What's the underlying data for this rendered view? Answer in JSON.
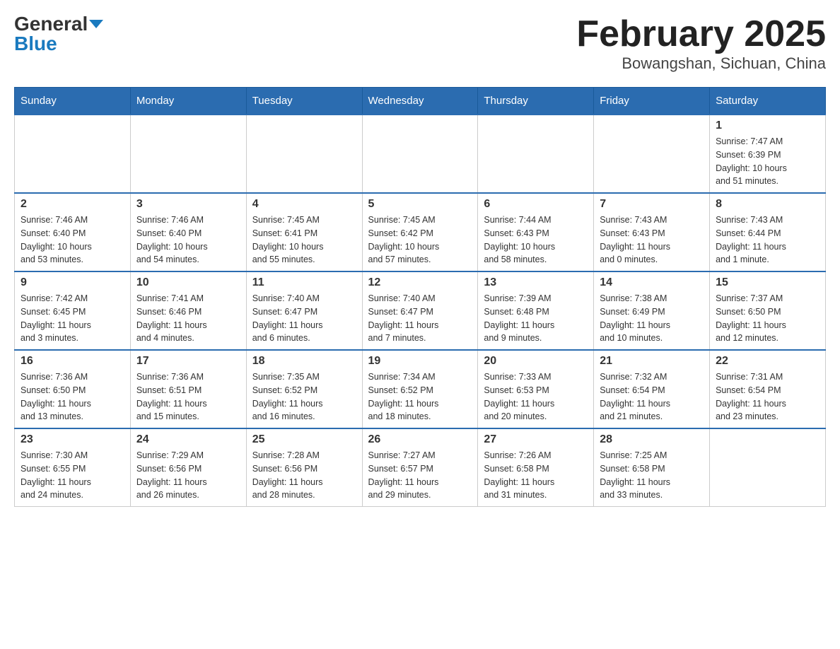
{
  "header": {
    "logo_general": "General",
    "logo_blue": "Blue",
    "month_title": "February 2025",
    "location": "Bowangshan, Sichuan, China"
  },
  "days_of_week": [
    "Sunday",
    "Monday",
    "Tuesday",
    "Wednesday",
    "Thursday",
    "Friday",
    "Saturday"
  ],
  "weeks": [
    {
      "days": [
        {
          "number": "",
          "info": ""
        },
        {
          "number": "",
          "info": ""
        },
        {
          "number": "",
          "info": ""
        },
        {
          "number": "",
          "info": ""
        },
        {
          "number": "",
          "info": ""
        },
        {
          "number": "",
          "info": ""
        },
        {
          "number": "1",
          "info": "Sunrise: 7:47 AM\nSunset: 6:39 PM\nDaylight: 10 hours\nand 51 minutes."
        }
      ]
    },
    {
      "days": [
        {
          "number": "2",
          "info": "Sunrise: 7:46 AM\nSunset: 6:40 PM\nDaylight: 10 hours\nand 53 minutes."
        },
        {
          "number": "3",
          "info": "Sunrise: 7:46 AM\nSunset: 6:40 PM\nDaylight: 10 hours\nand 54 minutes."
        },
        {
          "number": "4",
          "info": "Sunrise: 7:45 AM\nSunset: 6:41 PM\nDaylight: 10 hours\nand 55 minutes."
        },
        {
          "number": "5",
          "info": "Sunrise: 7:45 AM\nSunset: 6:42 PM\nDaylight: 10 hours\nand 57 minutes."
        },
        {
          "number": "6",
          "info": "Sunrise: 7:44 AM\nSunset: 6:43 PM\nDaylight: 10 hours\nand 58 minutes."
        },
        {
          "number": "7",
          "info": "Sunrise: 7:43 AM\nSunset: 6:43 PM\nDaylight: 11 hours\nand 0 minutes."
        },
        {
          "number": "8",
          "info": "Sunrise: 7:43 AM\nSunset: 6:44 PM\nDaylight: 11 hours\nand 1 minute."
        }
      ]
    },
    {
      "days": [
        {
          "number": "9",
          "info": "Sunrise: 7:42 AM\nSunset: 6:45 PM\nDaylight: 11 hours\nand 3 minutes."
        },
        {
          "number": "10",
          "info": "Sunrise: 7:41 AM\nSunset: 6:46 PM\nDaylight: 11 hours\nand 4 minutes."
        },
        {
          "number": "11",
          "info": "Sunrise: 7:40 AM\nSunset: 6:47 PM\nDaylight: 11 hours\nand 6 minutes."
        },
        {
          "number": "12",
          "info": "Sunrise: 7:40 AM\nSunset: 6:47 PM\nDaylight: 11 hours\nand 7 minutes."
        },
        {
          "number": "13",
          "info": "Sunrise: 7:39 AM\nSunset: 6:48 PM\nDaylight: 11 hours\nand 9 minutes."
        },
        {
          "number": "14",
          "info": "Sunrise: 7:38 AM\nSunset: 6:49 PM\nDaylight: 11 hours\nand 10 minutes."
        },
        {
          "number": "15",
          "info": "Sunrise: 7:37 AM\nSunset: 6:50 PM\nDaylight: 11 hours\nand 12 minutes."
        }
      ]
    },
    {
      "days": [
        {
          "number": "16",
          "info": "Sunrise: 7:36 AM\nSunset: 6:50 PM\nDaylight: 11 hours\nand 13 minutes."
        },
        {
          "number": "17",
          "info": "Sunrise: 7:36 AM\nSunset: 6:51 PM\nDaylight: 11 hours\nand 15 minutes."
        },
        {
          "number": "18",
          "info": "Sunrise: 7:35 AM\nSunset: 6:52 PM\nDaylight: 11 hours\nand 16 minutes."
        },
        {
          "number": "19",
          "info": "Sunrise: 7:34 AM\nSunset: 6:52 PM\nDaylight: 11 hours\nand 18 minutes."
        },
        {
          "number": "20",
          "info": "Sunrise: 7:33 AM\nSunset: 6:53 PM\nDaylight: 11 hours\nand 20 minutes."
        },
        {
          "number": "21",
          "info": "Sunrise: 7:32 AM\nSunset: 6:54 PM\nDaylight: 11 hours\nand 21 minutes."
        },
        {
          "number": "22",
          "info": "Sunrise: 7:31 AM\nSunset: 6:54 PM\nDaylight: 11 hours\nand 23 minutes."
        }
      ]
    },
    {
      "days": [
        {
          "number": "23",
          "info": "Sunrise: 7:30 AM\nSunset: 6:55 PM\nDaylight: 11 hours\nand 24 minutes."
        },
        {
          "number": "24",
          "info": "Sunrise: 7:29 AM\nSunset: 6:56 PM\nDaylight: 11 hours\nand 26 minutes."
        },
        {
          "number": "25",
          "info": "Sunrise: 7:28 AM\nSunset: 6:56 PM\nDaylight: 11 hours\nand 28 minutes."
        },
        {
          "number": "26",
          "info": "Sunrise: 7:27 AM\nSunset: 6:57 PM\nDaylight: 11 hours\nand 29 minutes."
        },
        {
          "number": "27",
          "info": "Sunrise: 7:26 AM\nSunset: 6:58 PM\nDaylight: 11 hours\nand 31 minutes."
        },
        {
          "number": "28",
          "info": "Sunrise: 7:25 AM\nSunset: 6:58 PM\nDaylight: 11 hours\nand 33 minutes."
        },
        {
          "number": "",
          "info": ""
        }
      ]
    }
  ]
}
